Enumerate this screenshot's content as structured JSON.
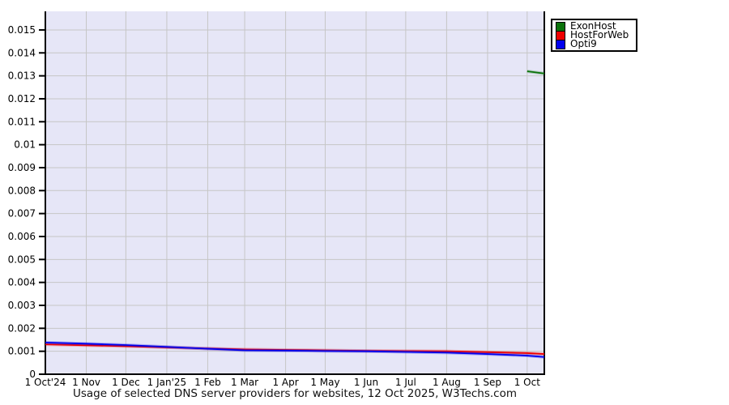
{
  "page": {
    "background": "#ffffff"
  },
  "chart_data": {
    "type": "line",
    "title": "Usage of selected DNS server providers for websites, 12 Oct 2025, W3Techs.com",
    "plot_background": "#e6e6f7",
    "gridline_color": "#c6c6c6",
    "axis_color": "#000000",
    "tick_label_color": "#000000",
    "grid": true,
    "legend_position": "outside-top-right",
    "layout": {
      "plot_left": 56,
      "plot_top": 14,
      "plot_right": 672,
      "plot_bottom": 462,
      "x_max_days": 378,
      "y_max": 0.01581
    },
    "ylim": [
      0,
      0.01581
    ],
    "xlabel": "",
    "ylabel": "",
    "y_ticks": [
      {
        "value": 0,
        "label": "0"
      },
      {
        "value": 0.001,
        "label": "0.001"
      },
      {
        "value": 0.002,
        "label": "0.002"
      },
      {
        "value": 0.003,
        "label": "0.003"
      },
      {
        "value": 0.004,
        "label": "0.004"
      },
      {
        "value": 0.005,
        "label": "0.005"
      },
      {
        "value": 0.006,
        "label": "0.006"
      },
      {
        "value": 0.007,
        "label": "0.007"
      },
      {
        "value": 0.008,
        "label": "0.008"
      },
      {
        "value": 0.009,
        "label": "0.009"
      },
      {
        "value": 0.01,
        "label": "0.01"
      },
      {
        "value": 0.011,
        "label": "0.011"
      },
      {
        "value": 0.012,
        "label": "0.012"
      },
      {
        "value": 0.013,
        "label": "0.013"
      },
      {
        "value": 0.014,
        "label": "0.014"
      },
      {
        "value": 0.015,
        "label": "0.015"
      }
    ],
    "x_ticks": [
      {
        "day": 0,
        "label": "1 Oct'24"
      },
      {
        "day": 31,
        "label": "1 Nov"
      },
      {
        "day": 61,
        "label": "1 Dec"
      },
      {
        "day": 92,
        "label": "1 Jan'25"
      },
      {
        "day": 123,
        "label": "1 Feb"
      },
      {
        "day": 151,
        "label": "1 Mar"
      },
      {
        "day": 182,
        "label": "1 Apr"
      },
      {
        "day": 212,
        "label": "1 May"
      },
      {
        "day": 243,
        "label": "1 Jun"
      },
      {
        "day": 273,
        "label": "1 Jul"
      },
      {
        "day": 304,
        "label": "1 Aug"
      },
      {
        "day": 335,
        "label": "1 Sep"
      },
      {
        "day": 365,
        "label": "1 Oct"
      }
    ],
    "series": [
      {
        "name": "ExonHost",
        "color": "#0a720a",
        "points": [
          {
            "day": 365,
            "value": 0.0132
          },
          {
            "day": 378,
            "value": 0.0131
          }
        ]
      },
      {
        "name": "HostForWeb",
        "color": "#ee0000",
        "points": [
          {
            "day": 0,
            "value": 0.0013
          },
          {
            "day": 31,
            "value": 0.00126
          },
          {
            "day": 61,
            "value": 0.00122
          },
          {
            "day": 92,
            "value": 0.00117
          },
          {
            "day": 123,
            "value": 0.00112
          },
          {
            "day": 151,
            "value": 0.00108
          },
          {
            "day": 182,
            "value": 0.00106
          },
          {
            "day": 212,
            "value": 0.00104
          },
          {
            "day": 243,
            "value": 0.00102
          },
          {
            "day": 273,
            "value": 0.00101
          },
          {
            "day": 304,
            "value": 0.001
          },
          {
            "day": 335,
            "value": 0.00096
          },
          {
            "day": 365,
            "value": 0.00092
          },
          {
            "day": 378,
            "value": 0.00088
          }
        ]
      },
      {
        "name": "Opti9",
        "color": "#0000ee",
        "points": [
          {
            "day": 0,
            "value": 0.00138
          },
          {
            "day": 31,
            "value": 0.00133
          },
          {
            "day": 61,
            "value": 0.00127
          },
          {
            "day": 92,
            "value": 0.00119
          },
          {
            "day": 123,
            "value": 0.00111
          },
          {
            "day": 151,
            "value": 0.00104
          },
          {
            "day": 182,
            "value": 0.00103
          },
          {
            "day": 212,
            "value": 0.00101
          },
          {
            "day": 243,
            "value": 0.001
          },
          {
            "day": 273,
            "value": 0.00097
          },
          {
            "day": 304,
            "value": 0.00094
          },
          {
            "day": 335,
            "value": 0.00088
          },
          {
            "day": 365,
            "value": 0.00081
          },
          {
            "day": 378,
            "value": 0.00075
          }
        ]
      }
    ]
  }
}
